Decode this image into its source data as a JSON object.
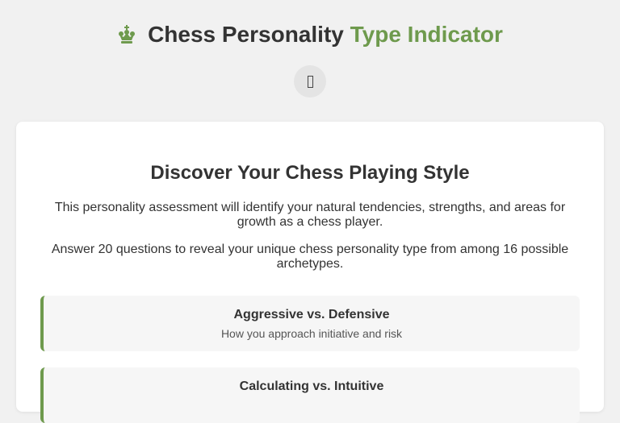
{
  "header": {
    "icon": "chess-king-icon",
    "title_main": "Chess Personality",
    "title_accent": "Type Indicator",
    "accent_color": "#6e9a4d"
  },
  "theme_toggle": {
    "icon": "theme-toggle-icon"
  },
  "intro_card": {
    "title": "Discover Your Chess Playing Style",
    "paragraph_1": "This personality assessment will identify your natural tendencies, strengths, and areas for growth as a chess player.",
    "paragraph_2": "Answer 20 questions to reveal your unique chess personality type from among 16 possible archetypes.",
    "dimensions": [
      {
        "name": "Aggressive vs. Defensive",
        "description": "How you approach initiative and risk"
      },
      {
        "name": "Calculating vs. Intuitive",
        "description": ""
      }
    ]
  }
}
